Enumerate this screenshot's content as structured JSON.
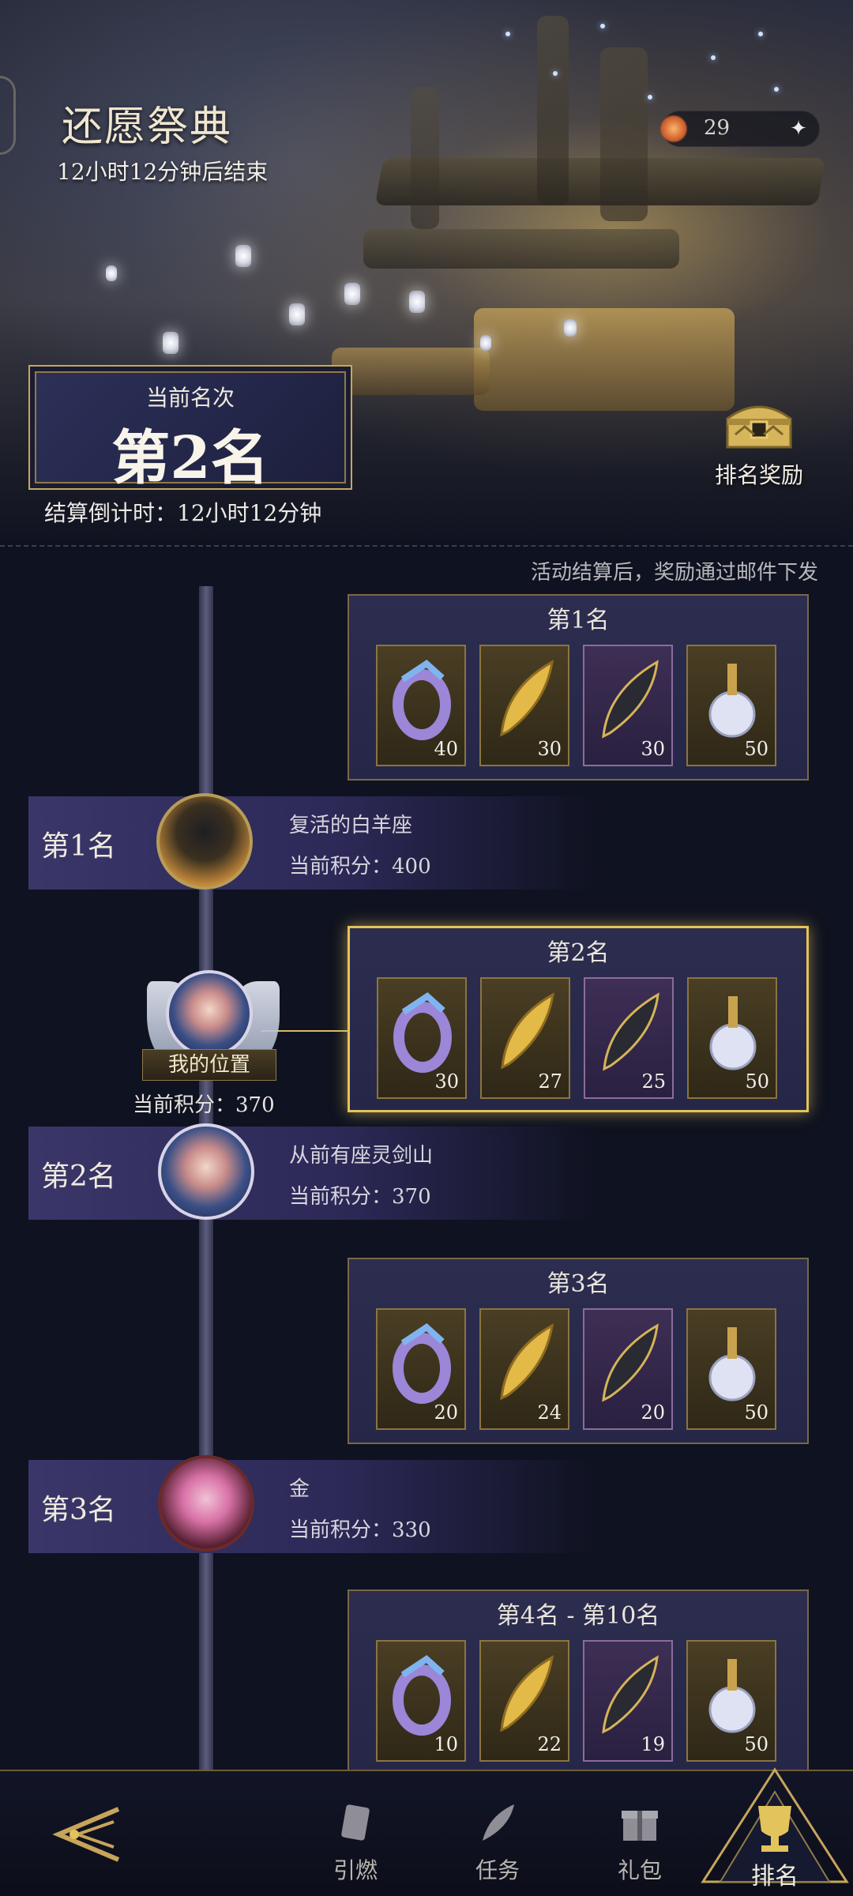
{
  "header": {
    "title": "还愿祭典",
    "timer": "12小时12分钟后结束",
    "currency_count": "29",
    "currency_add": "✦"
  },
  "rank_card": {
    "label": "当前名次",
    "value": "第2名"
  },
  "settle_countdown": "结算倒计时：12小时12分钟",
  "rank_reward_button": "排名奖励",
  "mail_note": "活动结算后，奖励通过邮件下发",
  "reward_panels": [
    {
      "title": "第1名",
      "items": [
        {
          "icon": "serpent-ring",
          "qty": "40"
        },
        {
          "icon": "golden-feather",
          "qty": "30"
        },
        {
          "icon": "dark-feather",
          "qty": "30"
        },
        {
          "icon": "crystal-bottle",
          "qty": "50"
        }
      ]
    },
    {
      "title": "第2名",
      "items": [
        {
          "icon": "serpent-ring",
          "qty": "30"
        },
        {
          "icon": "golden-feather",
          "qty": "27"
        },
        {
          "icon": "dark-feather",
          "qty": "25"
        },
        {
          "icon": "crystal-bottle",
          "qty": "50"
        }
      ]
    },
    {
      "title": "第3名",
      "items": [
        {
          "icon": "serpent-ring",
          "qty": "20"
        },
        {
          "icon": "golden-feather",
          "qty": "24"
        },
        {
          "icon": "dark-feather",
          "qty": "20"
        },
        {
          "icon": "crystal-bottle",
          "qty": "50"
        }
      ]
    },
    {
      "title": "第4名 - 第10名",
      "items": [
        {
          "icon": "serpent-ring",
          "qty": "10"
        },
        {
          "icon": "golden-feather",
          "qty": "22"
        },
        {
          "icon": "dark-feather",
          "qty": "19"
        },
        {
          "icon": "crystal-bottle",
          "qty": "50"
        }
      ]
    }
  ],
  "players": [
    {
      "rank": "第1名",
      "name": "复活的白羊座",
      "score": "当前积分：400"
    },
    {
      "rank": "第2名",
      "name": "从前有座灵剑山",
      "score": "当前积分：370"
    },
    {
      "rank": "第3名",
      "name": "金",
      "score": "当前积分：330"
    }
  ],
  "my_position": {
    "badge": "我的位置",
    "score": "当前积分：370"
  },
  "nav": {
    "items": [
      {
        "label": "引燃",
        "icon": "card-icon"
      },
      {
        "label": "任务",
        "icon": "quill-icon"
      },
      {
        "label": "礼包",
        "icon": "gift-icon"
      },
      {
        "label": "排名",
        "icon": "trophy-icon"
      }
    ]
  },
  "colors": {
    "gold": "#d9bb61",
    "panel": "#2c2d4f",
    "background": "#0f1220"
  }
}
